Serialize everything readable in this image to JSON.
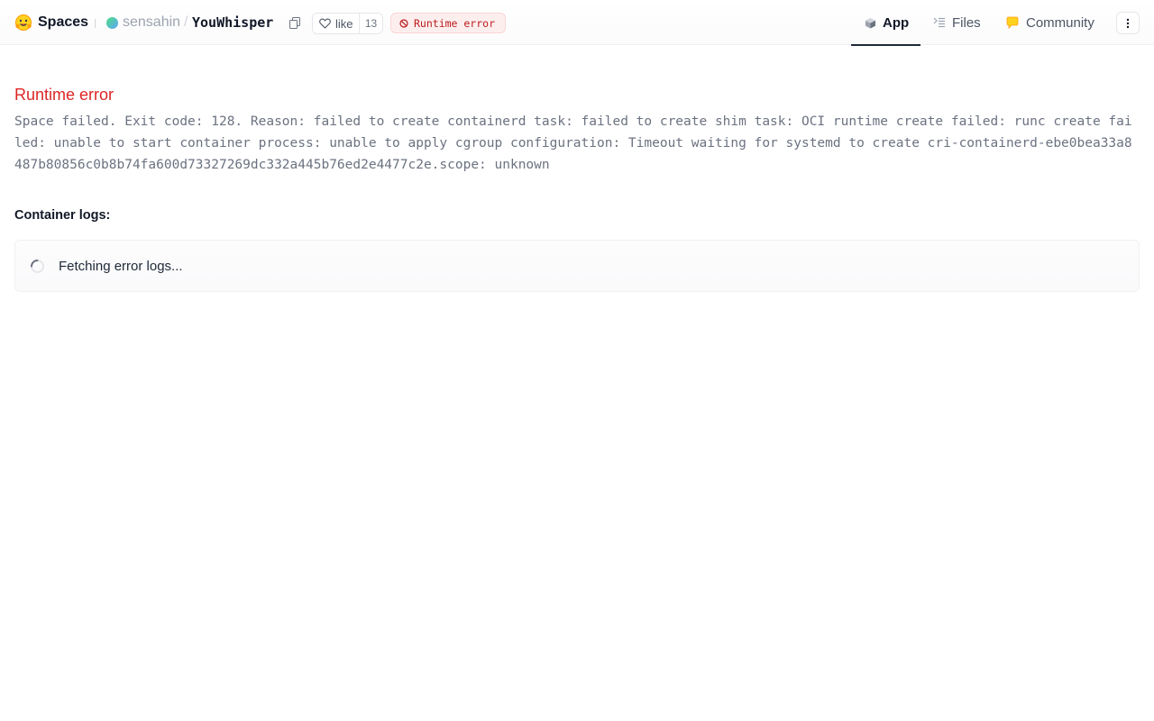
{
  "header": {
    "brand": "Spaces",
    "owner": "sensahin",
    "separator": "/",
    "repo": "YouWhisper",
    "like_label": "like",
    "like_count": "13",
    "status": "Runtime error",
    "tabs": [
      {
        "label": "App",
        "icon": "cube-icon",
        "active": true
      },
      {
        "label": "Files",
        "icon": "files-icon",
        "active": false
      },
      {
        "label": "Community",
        "icon": "community-icon",
        "active": false
      }
    ]
  },
  "main": {
    "error_title": "Runtime error",
    "error_message": "Space failed. Exit code: 128. Reason: failed to create containerd task: failed to create shim task: OCI runtime create failed: runc create failed: unable to start container process: unable to apply cgroup configuration: Timeout waiting for systemd to create cri-containerd-ebe0bea33a8487b80856c0b8b74fa600d73327269dc332a445b76ed2e4477c2e.scope: unknown",
    "logs_label": "Container logs:",
    "logs_status": "Fetching error logs..."
  },
  "colors": {
    "error": "#dc2626",
    "status_bg": "#fdeeee",
    "status_text": "#b91c1c"
  }
}
